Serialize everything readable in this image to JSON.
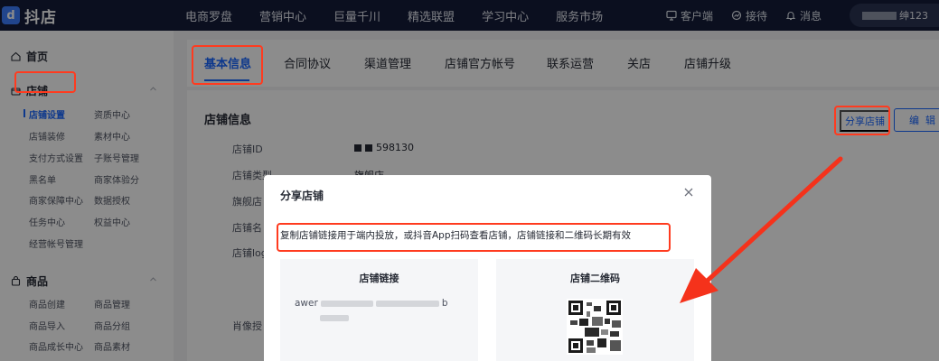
{
  "brand": {
    "logo_glyph": "d",
    "name": "抖店",
    "logo_color": "#3d7fff"
  },
  "top_nav": [
    "电商罗盘",
    "营销中心",
    "巨量千川",
    "精选联盟",
    "学习中心",
    "服务市场"
  ],
  "top_right": {
    "client": "客户端",
    "reception": "接待",
    "messages": "消息",
    "user_name_visible": "绅123"
  },
  "sidebar": {
    "home": "首页",
    "shop_group": "店铺",
    "shop_links": [
      "店铺设置",
      "资质中心",
      "店铺装修",
      "素材中心",
      "支付方式设置",
      "子账号管理",
      "黑名单",
      "商家体验分",
      "商家保障中心",
      "数据授权",
      "任务中心",
      "权益中心",
      "经营帐号管理"
    ],
    "goods_group": "商品",
    "goods_links": [
      "商品创建",
      "商品管理",
      "商品导入",
      "商品分组",
      "商品成长中心",
      "商品素材"
    ]
  },
  "tabs": [
    "基本信息",
    "合同协议",
    "渠道管理",
    "店铺官方帐号",
    "联系运营",
    "关店",
    "店铺升级"
  ],
  "shop_info": {
    "title": "店铺信息",
    "share_label": "分享店铺",
    "edit_label": "编 辑",
    "labels": [
      "店铺ID",
      "店铺类型",
      "旗舰店",
      "店铺名",
      "店铺log",
      "肖像授"
    ],
    "shop_id_suffix": "598130",
    "shop_type_value": "旗舰店"
  },
  "modal": {
    "title": "分享店铺",
    "description": "复制店铺链接用于端内投放，或抖音App扫码查看店铺，店铺链接和二维码长期有效",
    "link_panel_title": "店铺链接",
    "link_prefix": "awer",
    "link_mid": "b",
    "qr_panel_title": "店铺二维码"
  },
  "colors": {
    "accent": "#1966ff",
    "highlight": "#ff3b1f",
    "topbar": "#141d3a"
  }
}
